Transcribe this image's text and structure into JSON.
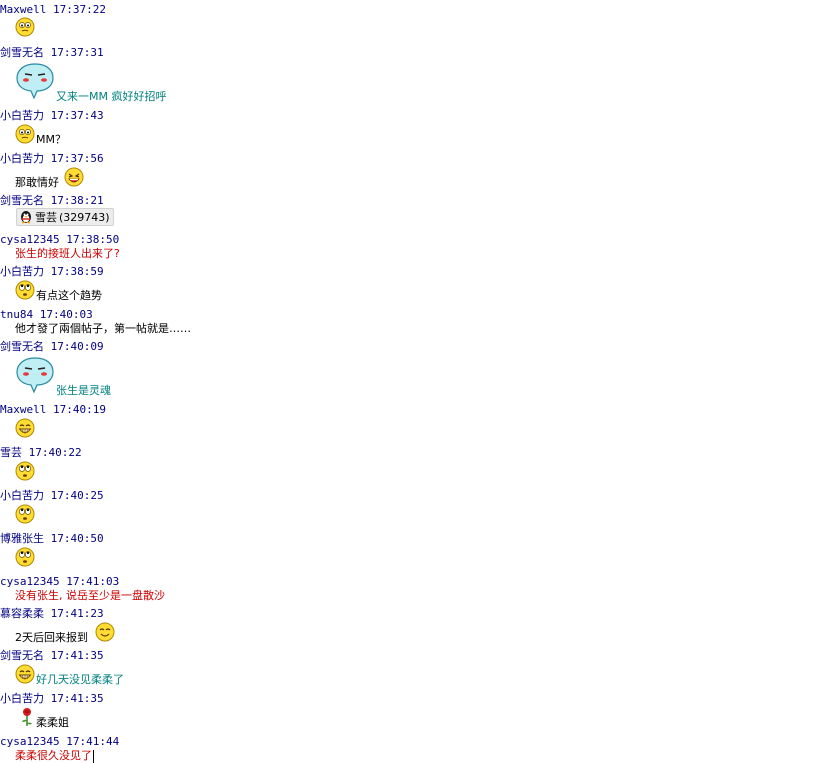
{
  "messages": [
    {
      "sender": "Maxwell",
      "time": "17:37:22",
      "text": "",
      "text_color": "#000000",
      "icon": "confused-smiley-icon"
    },
    {
      "sender": "剑雪无名",
      "time": "17:37:31",
      "text": "又来一MM 疯好好招呼",
      "text_color": "#008080",
      "icon": "speech-bubble-face-icon"
    },
    {
      "sender": "小白苦力",
      "time": "17:37:43",
      "text": "MM？",
      "text_color": "#000000",
      "icon": "confused-smiley-icon"
    },
    {
      "sender": "小白苦力",
      "time": "17:37:56",
      "text": "那敢情好",
      "text_color": "#000000",
      "icon": "laughing-smiley-icon"
    },
    {
      "sender": "剑雪无名",
      "time": "17:38:21",
      "text": "",
      "text_color": "#000000",
      "icon": "qq-penguin-icon",
      "chip": {
        "name": "雪芸",
        "id": "(329743)"
      }
    },
    {
      "sender": "cysa12345",
      "time": "17:38:50",
      "text": "张生的接班人出来了?",
      "text_color": "#cc0000",
      "icon": ""
    },
    {
      "sender": "小白苦力",
      "time": "17:38:59",
      "text": "有点这个趋势",
      "text_color": "#000000",
      "icon": "rolling-eyes-smiley-icon"
    },
    {
      "sender": "tnu84",
      "time": "17:40:03",
      "text": "他才發了兩個帖子，第一帖就是……",
      "text_color": "#000000",
      "icon": ""
    },
    {
      "sender": "剑雪无名",
      "time": "17:40:09",
      "text": "张生是灵魂",
      "text_color": "#008080",
      "icon": "speech-bubble-face-icon"
    },
    {
      "sender": "Maxwell",
      "time": "17:40:19",
      "text": "",
      "text_color": "#000000",
      "icon": "grin-smiley-icon"
    },
    {
      "sender": "雪芸",
      "time": "17:40:22",
      "text": "",
      "text_color": "#000000",
      "icon": "rolling-eyes-smiley-icon"
    },
    {
      "sender": "小白苦力",
      "time": "17:40:25",
      "text": "",
      "text_color": "#000000",
      "icon": "rolling-eyes-smiley-icon"
    },
    {
      "sender": "博雅张生",
      "time": "17:40:50",
      "text": "",
      "text_color": "#000000",
      "icon": "rolling-eyes-smiley-icon"
    },
    {
      "sender": "cysa12345",
      "time": "17:41:03",
      "text": "没有张生, 说岳至少是一盘散沙",
      "text_color": "#cc0000",
      "icon": ""
    },
    {
      "sender": "慕容柔柔",
      "time": "17:41:23",
      "text": "2天后回来报到",
      "text_color": "#000000",
      "icon": "wink-smiley-icon"
    },
    {
      "sender": "剑雪无名",
      "time": "17:41:35",
      "text": "好几天没见柔柔了",
      "text_color": "#008080",
      "icon": "grin-smiley-icon"
    },
    {
      "sender": "小白苦力",
      "time": "17:41:35",
      "text": "柔柔姐",
      "text_color": "#000000",
      "icon": "rose-icon"
    },
    {
      "sender": "cysa12345",
      "time": "17:41:44",
      "text": "柔柔很久没见了",
      "text_color": "#cc0000",
      "icon": ""
    }
  ],
  "colors": {
    "header": "#000080",
    "teal": "#008080",
    "red": "#cc0000",
    "black": "#000000"
  }
}
